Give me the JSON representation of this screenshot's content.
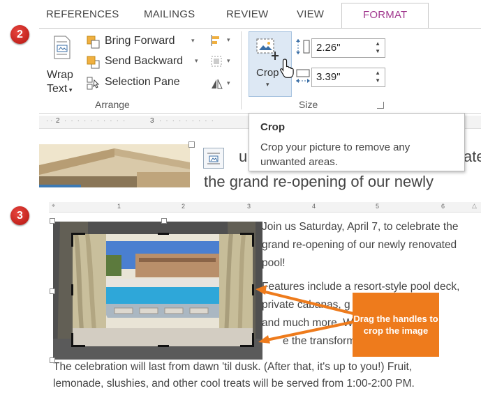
{
  "steps": {
    "two": "2",
    "three": "3"
  },
  "ribbon_tabs": [
    {
      "label": "REFERENCES"
    },
    {
      "label": "MAILINGS"
    },
    {
      "label": "REVIEW"
    },
    {
      "label": "VIEW"
    },
    {
      "label": "FORMAT"
    }
  ],
  "arrange": {
    "wrap_text_line1": "Wrap",
    "wrap_text_line2": "Text",
    "bring_forward": "Bring Forward",
    "send_backward": "Send Backward",
    "selection_pane": "Selection Pane",
    "group_label": "Arrange"
  },
  "size": {
    "crop_label": "Crop",
    "height_value": "2.26\"",
    "width_value": "3.39\"",
    "group_label": "Size"
  },
  "ruler_top": {
    "n2": "2",
    "n3": "3"
  },
  "tooltip": {
    "title": "Crop",
    "description": "Crop your picture to remove any unwanted areas."
  },
  "doc_top": {
    "line1_start": "u",
    "line1_end": "ate",
    "line2": "the grand re-opening of our newly"
  },
  "ruler_bottom": [
    "1",
    "2",
    "3",
    "4",
    "5",
    "6"
  ],
  "doc_bottom": {
    "lines": [
      "Join us Saturday, April 7, to celebrate the",
      "grand re-opening of our newly renovated",
      "pool!",
      "Features include a resort-style pool deck,",
      "private cabanas, g              rea,",
      "and much more. W              you to",
      "e the transform"
    ],
    "footer_line1": "The celebration will last from dawn 'til dusk. (After that, it's up to you!) Fruit,",
    "footer_line2": "lemonade, slushies, and other cool treats will be served from 1:00-2:00 PM."
  },
  "callout": {
    "text": "Drag the handles to crop the image"
  },
  "colors": {
    "format_tab": "#a23a8f",
    "callout": "#ee7b1c",
    "badge": "#c9201a"
  }
}
